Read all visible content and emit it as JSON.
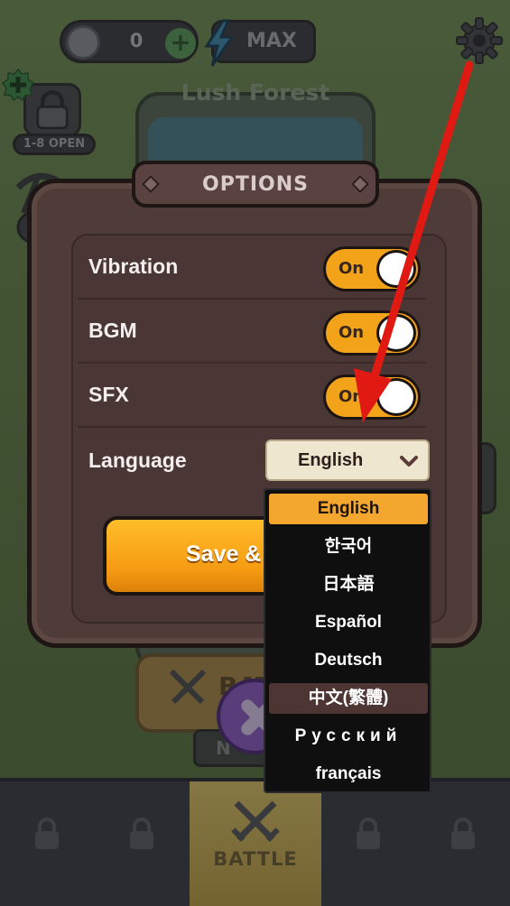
{
  "top_bar": {
    "coin_count": "0",
    "plus_icon": "plus-icon",
    "energy_label": "MAX",
    "energy_icon": "lightning-icon",
    "settings_icon": "gear-icon"
  },
  "stage": {
    "title": "Lush Forest",
    "lock_badge": "1-8 OPEN"
  },
  "background_battle": {
    "label": "BAT",
    "mode_label": "N"
  },
  "bottom_nav": {
    "tabs": [
      {
        "label": "",
        "icon": "lock-icon",
        "active": false
      },
      {
        "label": "",
        "icon": "lock-icon",
        "active": false
      },
      {
        "label": "BATTLE",
        "icon": "crossed-swords-icon",
        "active": true
      },
      {
        "label": "",
        "icon": "lock-icon",
        "active": false
      },
      {
        "label": "",
        "icon": "lock-icon",
        "active": false
      }
    ]
  },
  "options": {
    "title": "OPTIONS",
    "rows": [
      {
        "label": "Vibration",
        "toggle": "On"
      },
      {
        "label": "BGM",
        "toggle": "On"
      },
      {
        "label": "SFX",
        "toggle": "On"
      }
    ],
    "language_label": "Language",
    "language_selected": "English",
    "save_label": "Save & Close",
    "colors": {
      "toggle_on": "#f2a31a",
      "save_button": "#f59a12",
      "panel": "#4f3b38"
    }
  },
  "language_options": [
    "English",
    "한국어",
    "日本語",
    "Español",
    "Deutsch",
    "中文(繁體)",
    "Русский",
    "français"
  ]
}
